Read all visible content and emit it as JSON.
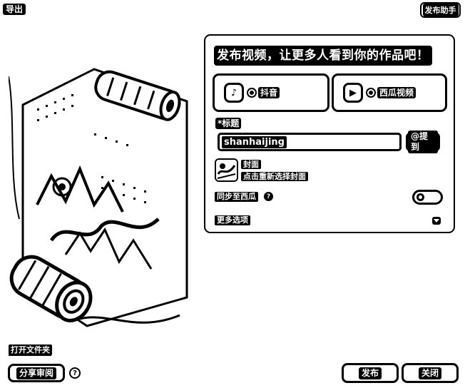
{
  "topbar": {
    "export_label": "导出",
    "helper_label": "发布助手"
  },
  "preview": {
    "open_folder_label": "打开文件夹"
  },
  "publish_panel": {
    "title": "发布视频，让更多人看到你的作品吧！",
    "platforms": [
      {
        "name": "抖音",
        "icon": "douyin-logo-icon",
        "selected": true
      },
      {
        "name": "西瓜视频",
        "icon": "xigua-logo-icon",
        "selected": true
      }
    ],
    "title_field": {
      "label": "*标题",
      "value": "shanhaijing"
    },
    "mention_label": "@提到",
    "cover": {
      "label": "封面",
      "hint": "点击重新选择封面"
    },
    "sync": {
      "label": "同步至西瓜",
      "help_icon": "?",
      "enabled": false
    },
    "more_options_label": "更多选项"
  },
  "footer": {
    "share_review_label": "分享审阅",
    "help_icon": "?",
    "publish_label": "发布",
    "close_label": "关闭"
  }
}
